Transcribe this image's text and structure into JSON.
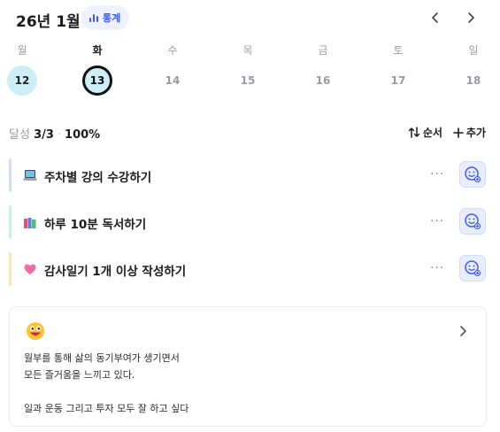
{
  "header": {
    "month_title": "26년 1월",
    "stats_label": "통계",
    "accent_color": "#3d5bf0"
  },
  "week": {
    "days": [
      {
        "weekday": "월",
        "date": "12",
        "state": "done"
      },
      {
        "weekday": "화",
        "date": "13",
        "state": "today"
      },
      {
        "weekday": "수",
        "date": "14",
        "state": "future"
      },
      {
        "weekday": "목",
        "date": "15",
        "state": "future"
      },
      {
        "weekday": "금",
        "date": "16",
        "state": "future"
      },
      {
        "weekday": "토",
        "date": "17",
        "state": "future"
      },
      {
        "weekday": "일",
        "date": "18",
        "state": "future"
      }
    ]
  },
  "summary": {
    "label": "달성",
    "count": "3/3",
    "percent": "100%"
  },
  "actions": {
    "sort_label": "순서",
    "add_label": "추가"
  },
  "tasks": [
    {
      "icon": "laptop-icon",
      "title": "주차별 강의 수강하기",
      "bar_color": "#d7dcf7"
    },
    {
      "icon": "books-icon",
      "title": "하루 10분 독서하기",
      "bar_color": "#c9f1dc"
    },
    {
      "icon": "pink-heart-icon",
      "title": "감사일기 1개 이상 작성하기",
      "bar_color": "#fde4bb"
    }
  ],
  "memo": {
    "icon": "grinning-face-icon",
    "lines": [
      "월부를 통해 삶의 동기부여가 생기면서",
      "모든 즐거움을 느끼고 있다.",
      "일과 운동 그리고 투자 모두 잘 하고 싶다"
    ]
  }
}
